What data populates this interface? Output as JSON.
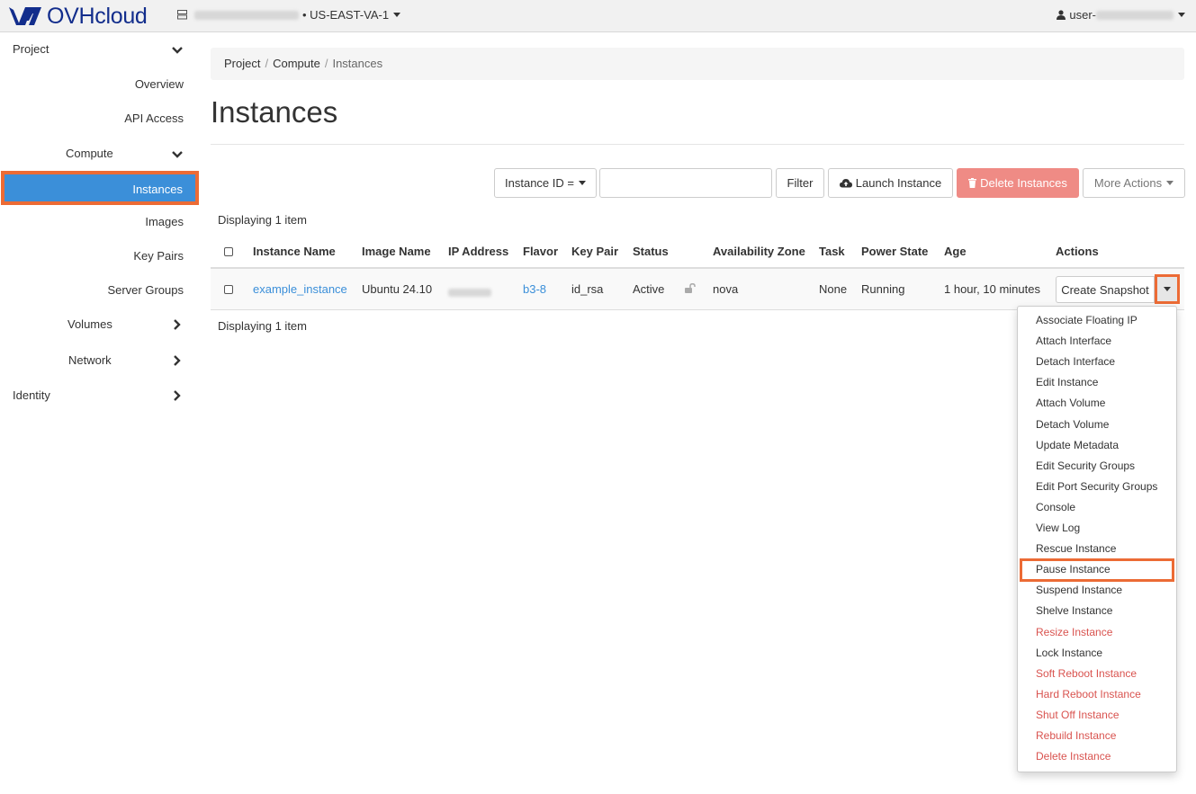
{
  "brand": {
    "name": "OVHcloud",
    "color": "#122d8c"
  },
  "header": {
    "region": "• US-EAST-VA-1",
    "user_prefix": "user-"
  },
  "sidebar": {
    "project": "Project",
    "overview": "Overview",
    "api_access": "API Access",
    "compute": "Compute",
    "instances": "Instances",
    "images": "Images",
    "key_pairs": "Key Pairs",
    "server_groups": "Server Groups",
    "volumes": "Volumes",
    "network": "Network",
    "identity": "Identity"
  },
  "breadcrumb": {
    "project": "Project",
    "compute": "Compute",
    "current": "Instances",
    "separator": "/"
  },
  "page_title": "Instances",
  "toolbar": {
    "filter_field": "Instance ID =",
    "filter_button": "Filter",
    "launch_button": "Launch Instance",
    "delete_button": "Delete Instances",
    "more_actions": "More Actions"
  },
  "table": {
    "displaying_top": "Displaying 1 item",
    "displaying_bottom": "Displaying 1 item",
    "headers": [
      "Instance Name",
      "Image Name",
      "IP Address",
      "Flavor",
      "Key Pair",
      "Status",
      "Availability Zone",
      "Task",
      "Power State",
      "Age",
      "Actions"
    ],
    "row": {
      "name": "example_instance",
      "image": "Ubuntu 24.10",
      "flavor": "b3-8",
      "key_pair": "id_rsa",
      "status": "Active",
      "zone": "nova",
      "task": "None",
      "power_state": "Running",
      "age": "1 hour, 10 minutes",
      "action": "Create Snapshot"
    }
  },
  "actions_menu": {
    "items": [
      {
        "label": "Associate Floating IP",
        "danger": false
      },
      {
        "label": "Attach Interface",
        "danger": false
      },
      {
        "label": "Detach Interface",
        "danger": false
      },
      {
        "label": "Edit Instance",
        "danger": false
      },
      {
        "label": "Attach Volume",
        "danger": false
      },
      {
        "label": "Detach Volume",
        "danger": false
      },
      {
        "label": "Update Metadata",
        "danger": false
      },
      {
        "label": "Edit Security Groups",
        "danger": false
      },
      {
        "label": "Edit Port Security Groups",
        "danger": false
      },
      {
        "label": "Console",
        "danger": false
      },
      {
        "label": "View Log",
        "danger": false
      },
      {
        "label": "Rescue Instance",
        "danger": false
      },
      {
        "label": "Pause Instance",
        "danger": false,
        "highlighted": true
      },
      {
        "label": "Suspend Instance",
        "danger": false
      },
      {
        "label": "Shelve Instance",
        "danger": false
      },
      {
        "label": "Resize Instance",
        "danger": true
      },
      {
        "label": "Lock Instance",
        "danger": false
      },
      {
        "label": "Soft Reboot Instance",
        "danger": true
      },
      {
        "label": "Hard Reboot Instance",
        "danger": true
      },
      {
        "label": "Shut Off Instance",
        "danger": true
      },
      {
        "label": "Rebuild Instance",
        "danger": true
      },
      {
        "label": "Delete Instance",
        "danger": true
      }
    ]
  },
  "colors": {
    "accent": "#3b8fd9",
    "highlight": "#ec6b35",
    "danger": "#d9534f",
    "danger_button": "#ef8b85"
  }
}
